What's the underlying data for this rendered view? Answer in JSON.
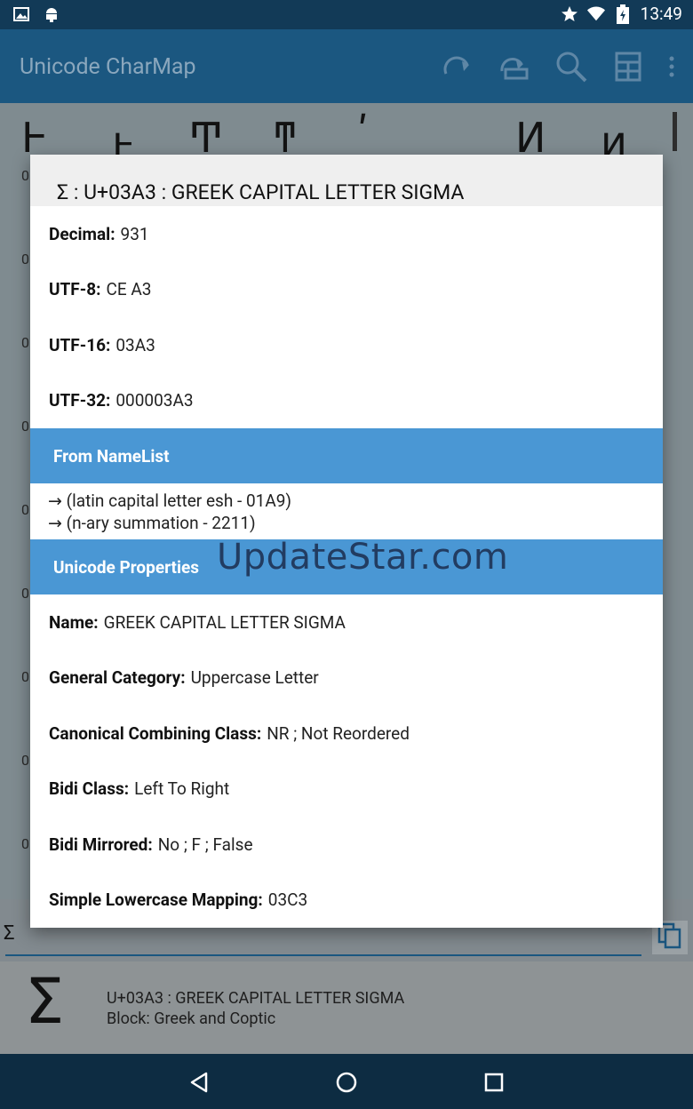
{
  "status_bar": {
    "time": "13:49"
  },
  "app_bar": {
    "title": "Unicode CharMap"
  },
  "background_grid": {
    "top_chars": [
      "Ͱ",
      "ͱ",
      "Ͳ",
      "ͳ",
      "ʹ",
      "Ͷ",
      "ͷ"
    ],
    "row_labels": [
      "0",
      "0",
      "0",
      "0",
      "0",
      "0",
      "0",
      "0",
      "0"
    ]
  },
  "dialog": {
    "title": "Σ : U+03A3 : GREEK CAPITAL LETTER SIGMA",
    "encodings": [
      {
        "label": "Decimal:",
        "value": "931"
      },
      {
        "label": "UTF-8:",
        "value": "CE A3"
      },
      {
        "label": "UTF-16:",
        "value": "03A3"
      },
      {
        "label": "UTF-32:",
        "value": "000003A3"
      }
    ],
    "namelist_header": "From NameList",
    "namelist": [
      "→ (latin capital letter esh - 01A9)",
      "→ (n-ary summation - 2211)"
    ],
    "properties_header": "Unicode Properties",
    "properties": [
      {
        "label": "Name:",
        "value": "GREEK CAPITAL LETTER SIGMA"
      },
      {
        "label": "General Category:",
        "value": "Uppercase Letter"
      },
      {
        "label": "Canonical Combining Class:",
        "value": "NR ; Not Reordered"
      },
      {
        "label": "Bidi Class:",
        "value": "Left To Right"
      },
      {
        "label": "Bidi Mirrored:",
        "value": "No ; F ; False"
      },
      {
        "label": "Simple Lowercase Mapping:",
        "value": "03C3"
      }
    ]
  },
  "watermark": "UpdateStar.com",
  "input": {
    "value": "Σ"
  },
  "char_info": {
    "glyph": "Σ",
    "line1": "U+03A3 : GREEK CAPITAL LETTER SIGMA",
    "line2": "Block: Greek and Coptic"
  }
}
